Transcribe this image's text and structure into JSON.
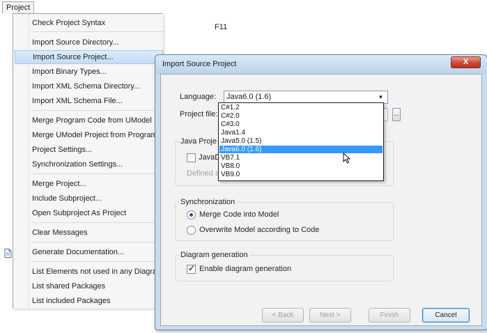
{
  "menubar": {
    "title": "Project"
  },
  "menu": {
    "items": [
      {
        "label": "Check Project Syntax",
        "shortcut": "F11"
      },
      {
        "label": "Import Source Directory..."
      },
      {
        "label": "Import Source Project..."
      },
      {
        "label": "Import Binary Types..."
      },
      {
        "label": "Import XML Schema Directory..."
      },
      {
        "label": "Import XML Schema File..."
      },
      {
        "label": "Merge Program Code from UModel"
      },
      {
        "label": "Merge UModel Project from Program Code"
      },
      {
        "label": "Project Settings..."
      },
      {
        "label": "Synchronization Settings..."
      },
      {
        "label": "Merge Project..."
      },
      {
        "label": "Include Subproject..."
      },
      {
        "label": "Open Subproject As Project"
      },
      {
        "label": "Clear Messages"
      },
      {
        "label": "Generate Documentation...",
        "icon": "document-icon"
      },
      {
        "label": "List Elements not used in any Diagram"
      },
      {
        "label": "List shared Packages"
      },
      {
        "label": "List included Packages"
      }
    ]
  },
  "dialog": {
    "title": "Import Source Project",
    "close_label": "X",
    "language": {
      "label": "Language:",
      "value": "Java6.0 (1.6)"
    },
    "project_file": {
      "label": "Project file:",
      "value": "",
      "browse_label": "..."
    },
    "java_group": {
      "title": "Java Proje",
      "checkbox_label": "JavaD",
      "defined_label": "Defined a"
    },
    "sync_group": {
      "title": "Synchronization",
      "options": [
        "Merge Code into Model",
        "Overwrite Model according to Code"
      ],
      "selected": "Merge Code into Model"
    },
    "diagram_group": {
      "title": "Diagram generation",
      "checkbox_label": "Enable diagram generation",
      "checked": true
    },
    "dropdown_options": [
      "C#1.2",
      "C#2.0",
      "C#3.0",
      "Java1.4",
      "Java5.0 (1.5)",
      "Java6.0 (1.6)",
      "VB7.1",
      "VB8.0",
      "VB9.0"
    ],
    "dropdown_selected": "Java6.0 (1.6)",
    "buttons": {
      "back": "< Back",
      "next": "Next >",
      "finish": "Finish",
      "cancel": "Cancel"
    }
  },
  "colors": {
    "highlight": "#3399ff",
    "menu_highlight": "#c4dcf4",
    "dialog_frame": "#c9dcef",
    "close_button": "#c94a34"
  }
}
